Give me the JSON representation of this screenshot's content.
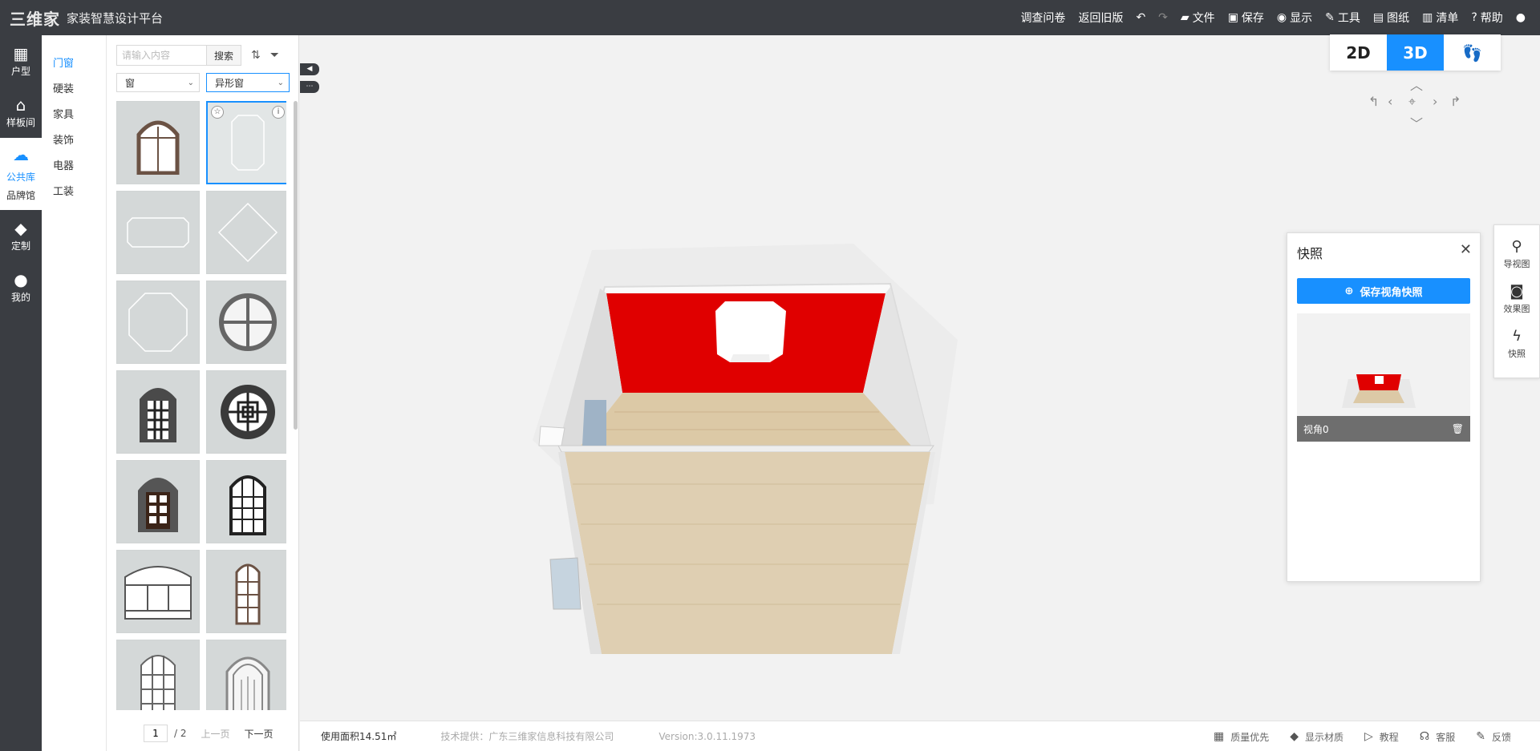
{
  "topbar": {
    "logo_mark": "三维家",
    "title": "家装智慧设计平台",
    "menu": {
      "survey": "调查问卷",
      "old_version": "返回旧版",
      "file": "文件",
      "save": "保存",
      "display": "显示",
      "tools": "工具",
      "drawings": "图纸",
      "list": "清单",
      "help": "帮助"
    }
  },
  "rail": {
    "floorplan": "户型",
    "showroom": "样板间",
    "public_lib": "公共库",
    "brand_hall": "品牌馆",
    "custom": "定制",
    "mine": "我的"
  },
  "categories": [
    "门窗",
    "硬装",
    "家具",
    "装饰",
    "电器",
    "工装"
  ],
  "library": {
    "search_placeholder": "请输入内容",
    "search_button": "搜索",
    "select_type": "窗",
    "select_subtype": "异形窗"
  },
  "pager": {
    "current": "1",
    "total": "/ 2",
    "prev": "上一页",
    "next": "下一页"
  },
  "viewtabs": {
    "two_d": "2D",
    "three_d": "3D",
    "walk": ""
  },
  "snapshot": {
    "title": "快照",
    "save_button": "保存视角快照",
    "item_label": "视角0"
  },
  "dock": {
    "navigator": "导视图",
    "render": "效果图",
    "snapshot": "快照"
  },
  "status": {
    "area": "使用面积14.51㎡",
    "tech": "技术提供：广东三维家信息科技有限公司",
    "version": "Version:3.0.11.1973",
    "quality": "质量优先",
    "material": "显示材质",
    "tutorial": "教程",
    "service": "客服",
    "feedback": "反馈"
  },
  "colors": {
    "accent": "#1890ff",
    "topbar": "#3a3d42",
    "wall_red": "#e00000",
    "floor_wood": "#d9c8a8"
  }
}
